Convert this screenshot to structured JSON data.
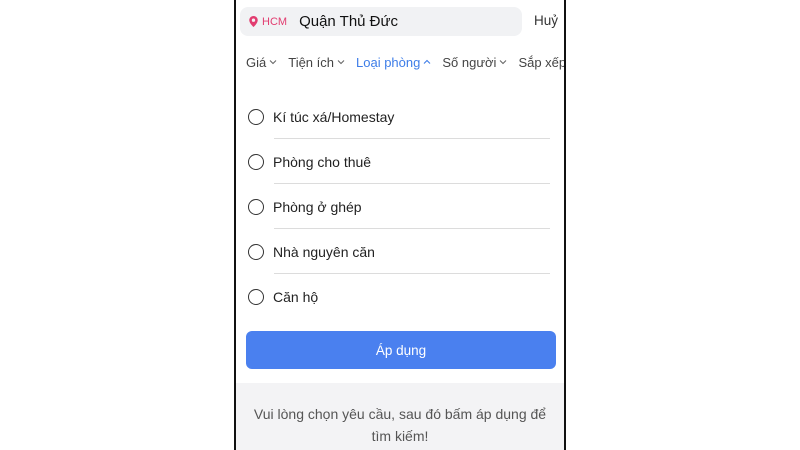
{
  "search": {
    "location": "HCM",
    "query": "Quận Thủ Đức",
    "cancel_label": "Huỷ"
  },
  "filters": [
    {
      "label": "Giá",
      "active": false
    },
    {
      "label": "Tiện ích",
      "active": false
    },
    {
      "label": "Loại phòng",
      "active": true
    },
    {
      "label": "Số người",
      "active": false
    },
    {
      "label": "Sắp xếp",
      "active": false
    }
  ],
  "room_types": [
    {
      "label": "Kí túc xá/Homestay",
      "selected": false
    },
    {
      "label": "Phòng cho thuê",
      "selected": false
    },
    {
      "label": "Phòng ở ghép",
      "selected": false
    },
    {
      "label": "Nhà nguyên căn",
      "selected": false
    },
    {
      "label": "Căn hộ",
      "selected": false
    }
  ],
  "apply_label": "Áp dụng",
  "hint": "Vui lòng chọn yêu cầu, sau đó bấm áp dụng để tìm kiếm!",
  "colors": {
    "accent": "#4a80ef",
    "active_tab": "#3d7de8",
    "location_pin": "#e23d70"
  }
}
